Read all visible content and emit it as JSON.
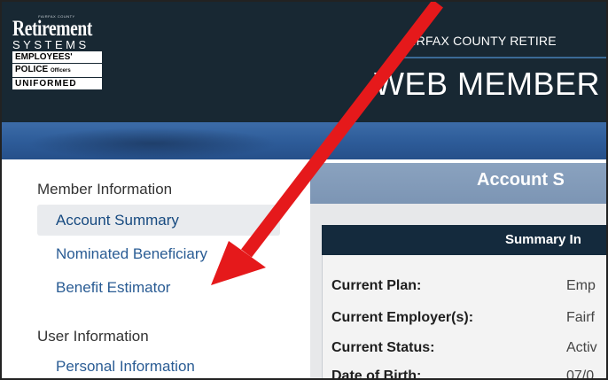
{
  "logo": {
    "county": "FAIRFAX COUNTY",
    "retirement": "Retirement",
    "systems": "SYSTEMS",
    "employees": "EMPLOYEES'",
    "police": "POLICE",
    "officers": "Officers",
    "uniformed": "UNIFORMED"
  },
  "header": {
    "county_line": "AIRFAX COUNTY RETIRE",
    "title": "WEB MEMBER"
  },
  "sidebar": {
    "member_section": "Member Information",
    "items": [
      {
        "label": "Account Summary",
        "active": true
      },
      {
        "label": "Nominated Beneficiary"
      },
      {
        "label": "Benefit Estimator"
      }
    ],
    "user_section": "User Information",
    "user_items": [
      {
        "label": "Personal Information"
      }
    ]
  },
  "main": {
    "tab_title": "Account S",
    "card_title": "Summary In",
    "rows": [
      {
        "label": "Current Plan:",
        "value": "Emp"
      },
      {
        "label": "Current Employer(s):",
        "value": "Fairf"
      },
      {
        "label": "Current Status:",
        "value": "Activ"
      },
      {
        "label": "Date of Birth:",
        "value": "07/0"
      }
    ]
  },
  "colors": {
    "header_bg": "#182833",
    "band_blue": "#2d5b98",
    "link_blue": "#1b4f87",
    "arrow_red": "#e5191b"
  },
  "icons": [
    "red-pointer-arrow-icon"
  ]
}
